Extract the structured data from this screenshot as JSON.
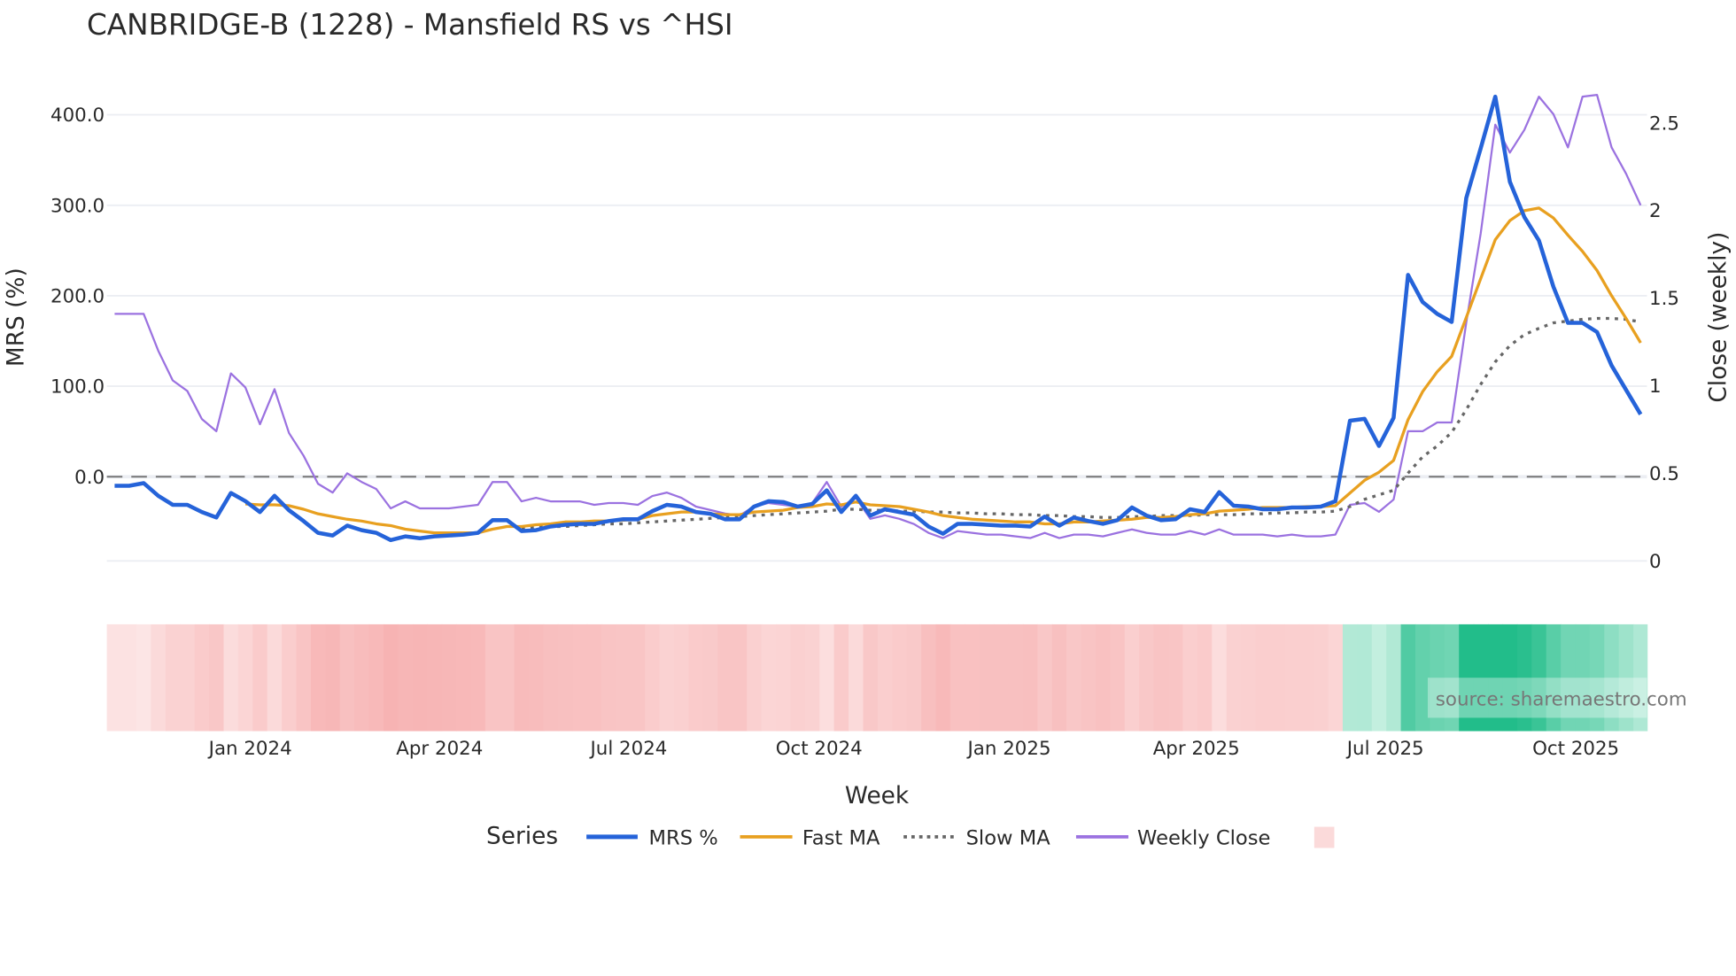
{
  "chart_data": {
    "type": "line",
    "title": "CANBRIDGE-B (1228) - Mansfield RS vs ^HSI",
    "xlabel": "Week",
    "ylabel": "MRS (%)",
    "y2label": "Close (weekly)",
    "ylim": [
      -93,
      453
    ],
    "y2lim": [
      0,
      2.82
    ],
    "yticks": [
      {
        "v": 400,
        "label": "400.0"
      },
      {
        "v": 300,
        "label": "300.0"
      },
      {
        "v": 200,
        "label": "200.0"
      },
      {
        "v": 100,
        "label": "100.0"
      },
      {
        "v": 0,
        "label": "0.0"
      }
    ],
    "y2ticks": [
      {
        "v": 2.5,
        "label": "2.5"
      },
      {
        "v": 2,
        "label": "2"
      },
      {
        "v": 1.5,
        "label": "1.5"
      },
      {
        "v": 1,
        "label": "1"
      },
      {
        "v": 0.5,
        "label": "0.5"
      },
      {
        "v": 0,
        "label": "0"
      }
    ],
    "xticks": [
      {
        "week": 9.34,
        "label": "Jan 2024"
      },
      {
        "week": 22.36,
        "label": "Apr 2024"
      },
      {
        "week": 35.38,
        "label": "Jul 2024"
      },
      {
        "week": 48.47,
        "label": "Oct 2024"
      },
      {
        "week": 61.56,
        "label": "Jan 2025"
      },
      {
        "week": 74.43,
        "label": "Apr 2025"
      },
      {
        "week": 87.44,
        "label": "Jul 2025"
      },
      {
        "week": 100.54,
        "label": "Oct 2025"
      }
    ],
    "zero_line": 0,
    "grid": true,
    "legend_title": "Series",
    "legend_position": "bottom",
    "series": [
      {
        "name": "MRS %",
        "color": "#2563d9",
        "axis": "left",
        "style": "solid",
        "values": [
          -10,
          -10,
          -7,
          -21,
          -31,
          -31,
          -39,
          -45,
          -18,
          -27,
          -39,
          -21,
          -37,
          -49,
          -62,
          -65,
          -54,
          -59,
          -62,
          -70,
          -66,
          -68,
          -66,
          -65,
          -64,
          -62,
          -48,
          -48,
          -60,
          -59,
          -55,
          -53,
          -52,
          -52,
          -49,
          -47,
          -47,
          -38,
          -31,
          -33,
          -39,
          -41,
          -47,
          -47,
          -33,
          -27,
          -28,
          -33,
          -30,
          -15,
          -39,
          -21,
          -43,
          -36,
          -39,
          -42,
          -55,
          -63,
          -52,
          -52,
          -53,
          -54,
          -54,
          -55,
          -44,
          -54,
          -45,
          -49,
          -52,
          -48,
          -34,
          -43,
          -48,
          -47,
          -36,
          -39,
          -17,
          -32,
          -33,
          -36,
          -36,
          -34,
          -34,
          -33,
          -27,
          62,
          64,
          34,
          65,
          223,
          193,
          180,
          171,
          308,
          363,
          420,
          326,
          287,
          261,
          210,
          170,
          170,
          160,
          123,
          96,
          69
        ]
      },
      {
        "name": "Fast MA",
        "color": "#e8a020",
        "axis": "left",
        "style": "solid",
        "values": [
          null,
          null,
          null,
          null,
          null,
          null,
          null,
          null,
          null,
          -30,
          -31,
          -31,
          -32,
          -36,
          -41,
          -44,
          -47,
          -49,
          -52,
          -54,
          -58,
          -60,
          -62,
          -62,
          -62,
          -62,
          -58,
          -55,
          -55,
          -53,
          -52,
          -50,
          -50,
          -49,
          -49,
          -48,
          -47,
          -43,
          -41,
          -39,
          -39,
          -41,
          -42,
          -42,
          -39,
          -38,
          -37,
          -34,
          -33,
          -30,
          -31,
          -28,
          -31,
          -32,
          -33,
          -36,
          -39,
          -43,
          -45,
          -47,
          -48,
          -49,
          -50,
          -50,
          -52,
          -52,
          -50,
          -50,
          -49,
          -48,
          -47,
          -45,
          -45,
          -44,
          -42,
          -41,
          -38,
          -37,
          -36,
          -34,
          -34,
          -34,
          -33,
          -33,
          -32,
          -18,
          -4,
          5,
          18,
          63,
          94,
          116,
          133,
          176,
          219,
          262,
          283,
          294,
          297,
          286,
          267,
          249,
          228,
          200,
          175,
          148
        ]
      },
      {
        "name": "Slow MA",
        "color": "#666666",
        "axis": "left",
        "style": "dotted",
        "values": [
          null,
          null,
          null,
          null,
          null,
          null,
          null,
          null,
          null,
          null,
          null,
          null,
          null,
          null,
          null,
          null,
          null,
          null,
          null,
          null,
          null,
          null,
          null,
          null,
          null,
          null,
          null,
          null,
          -57,
          -56,
          -55,
          -55,
          -54,
          -53,
          -52,
          -52,
          -51,
          -50,
          -49,
          -48,
          -47,
          -46,
          -45,
          -44,
          -43,
          -42,
          -41,
          -40,
          -39,
          -38,
          -36,
          -36,
          -37,
          -37,
          -38,
          -38,
          -39,
          -39,
          -40,
          -40,
          -41,
          -41,
          -42,
          -42,
          -43,
          -43,
          -44,
          -44,
          -45,
          -45,
          -44,
          -44,
          -43,
          -43,
          -43,
          -42,
          -42,
          -42,
          -41,
          -41,
          -40,
          -40,
          -39,
          -39,
          -38,
          -33,
          -25,
          -20,
          -15,
          4,
          22,
          34,
          49,
          74,
          102,
          127,
          145,
          157,
          164,
          170,
          172,
          174,
          175,
          175,
          174,
          171
        ]
      },
      {
        "name": "Weekly Close",
        "color": "#9b72e0",
        "axis": "right",
        "style": "solid",
        "values": [
          1.41,
          1.41,
          1.41,
          1.2,
          1.03,
          0.97,
          0.81,
          0.74,
          1.07,
          0.99,
          0.78,
          0.98,
          0.73,
          0.6,
          0.44,
          0.39,
          0.5,
          0.45,
          0.41,
          0.3,
          0.34,
          0.3,
          0.3,
          0.3,
          0.31,
          0.32,
          0.45,
          0.45,
          0.34,
          0.36,
          0.34,
          0.34,
          0.34,
          0.32,
          0.33,
          0.33,
          0.32,
          0.37,
          0.39,
          0.36,
          0.31,
          0.29,
          0.27,
          0.26,
          0.31,
          0.33,
          0.32,
          0.31,
          0.33,
          0.45,
          0.31,
          0.36,
          0.24,
          0.26,
          0.24,
          0.21,
          0.16,
          0.13,
          0.17,
          0.16,
          0.15,
          0.15,
          0.14,
          0.13,
          0.16,
          0.13,
          0.15,
          0.15,
          0.14,
          0.16,
          0.18,
          0.16,
          0.15,
          0.15,
          0.17,
          0.15,
          0.18,
          0.15,
          0.15,
          0.15,
          0.14,
          0.15,
          0.14,
          0.14,
          0.15,
          0.32,
          0.33,
          0.28,
          0.35,
          0.74,
          0.74,
          0.79,
          0.79,
          1.36,
          1.87,
          2.49,
          2.33,
          2.46,
          2.65,
          2.55,
          2.36,
          2.65,
          2.66,
          2.36,
          2.21,
          2.03
        ]
      }
    ],
    "heatmap": {
      "source_series": "MRS %",
      "negative_color": "#f7b3b3",
      "positive_color": "#22bd8a",
      "neutral_color": "#fdeaea",
      "legend_swatch_color": "#fbdada"
    },
    "watermark": "source: sharemaestro.com"
  }
}
